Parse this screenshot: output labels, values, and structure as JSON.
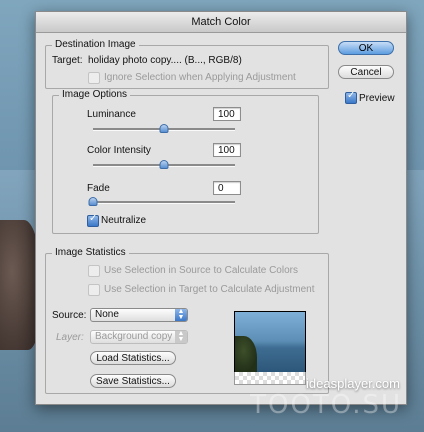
{
  "dialog": {
    "title": "Match Color",
    "ok_label": "OK",
    "cancel_label": "Cancel",
    "preview_label": "Preview",
    "preview_checked": true
  },
  "destination": {
    "group_title": "Destination Image",
    "target_label": "Target:",
    "target_value": "holiday photo copy.... (B..., RGB/8)",
    "ignore_selection_label": "Ignore Selection when Applying Adjustment"
  },
  "image_options": {
    "group_title": "Image Options",
    "luminance_label": "Luminance",
    "luminance_value": "100",
    "color_intensity_label": "Color Intensity",
    "color_intensity_value": "100",
    "fade_label": "Fade",
    "fade_value": "0",
    "neutralize_label": "Neutralize",
    "neutralize_checked": true,
    "slider_levels": {
      "luminance": 0.5,
      "color_intensity": 0.5,
      "fade": 0.0
    }
  },
  "statistics": {
    "group_title": "Image Statistics",
    "use_source_label": "Use Selection in Source to Calculate Colors",
    "use_target_label": "Use Selection in Target to Calculate Adjustment",
    "source_label": "Source:",
    "source_value": "None",
    "layer_label": "Layer:",
    "layer_value": "Background copy",
    "load_label": "Load Statistics...",
    "save_label": "Save Statistics..."
  },
  "watermark": {
    "line1": "ideasplayer.com",
    "line2": "TOOTO.SU"
  }
}
